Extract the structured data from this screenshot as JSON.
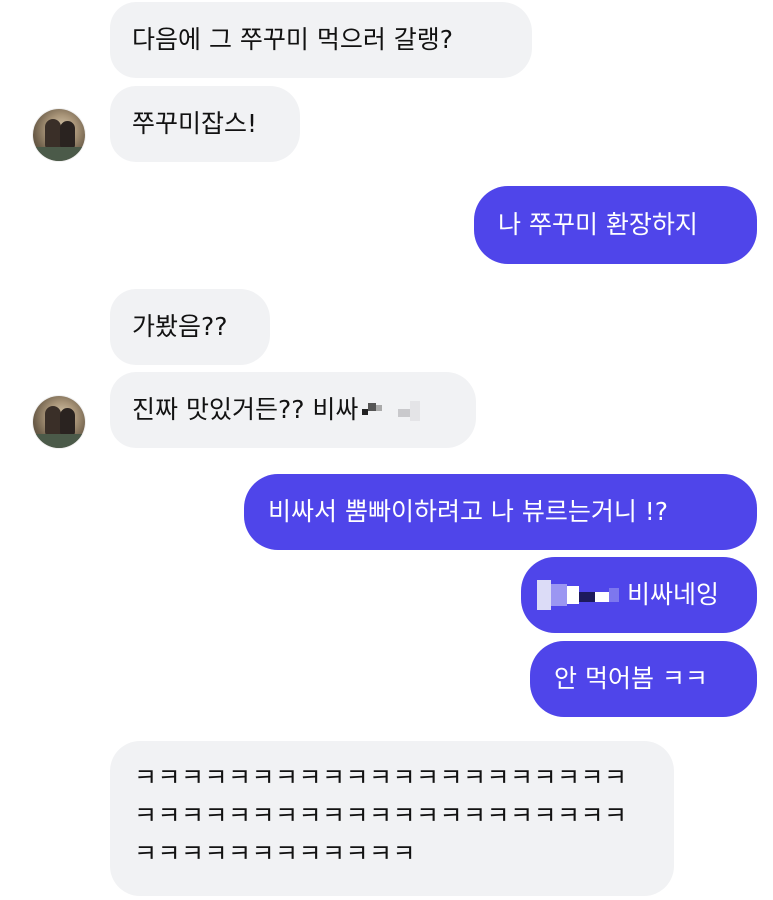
{
  "messages": [
    {
      "id": "m1",
      "side": "in",
      "text": "다음에 그 쭈꾸미 먹으러 갈랭?"
    },
    {
      "id": "m2",
      "side": "in",
      "text": "쭈꾸미잡스!"
    },
    {
      "id": "m3",
      "side": "out",
      "text": "나 쭈꾸미 환장하지"
    },
    {
      "id": "m4",
      "side": "in",
      "text": "가봤음??"
    },
    {
      "id": "m5",
      "side": "in",
      "text": "진짜 맛있거든?? 비싸"
    },
    {
      "id": "m6",
      "side": "out",
      "text": "비싸서 뿜빠이하려고 나 뷰르는거니 !?"
    },
    {
      "id": "m7",
      "side": "out",
      "text": "비싸네잉"
    },
    {
      "id": "m8",
      "side": "out",
      "text": "안 먹어봄 ㅋㅋ"
    },
    {
      "id": "m9",
      "side": "in",
      "lines": [
        "ㅋㅋㅋㅋㅋㅋㅋㅋㅋㅋㅋㅋㅋㅋㅋㅋㅋㅋㅋㅋㅋ",
        "ㅋㅋㅋㅋㅋㅋㅋㅋㅋㅋㅋㅋㅋㅋㅋㅋㅋㅋㅋㅋㅋ",
        "ㅋㅋㅋㅋㅋㅋㅋㅋㅋㅋㅋㅋ"
      ]
    }
  ],
  "colors": {
    "incoming_bubble": "#f1f2f4",
    "outgoing_bubble": "#4f45ea",
    "incoming_text": "#121212",
    "outgoing_text": "#ffffff"
  },
  "icons": {
    "avatar": "profile-photo"
  }
}
